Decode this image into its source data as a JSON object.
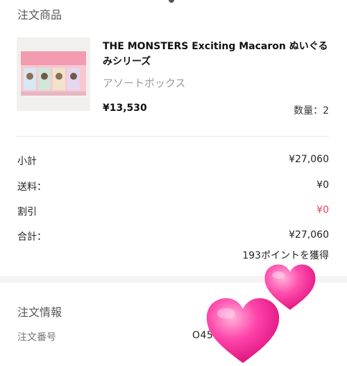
{
  "order_items": {
    "section_title": "注文商品",
    "product": {
      "name": "THE MONSTERS Exciting Macaron ぬいぐるみシリーズ",
      "variant": "アソートボックス",
      "price": "¥13,530",
      "quantity": "数量：2"
    }
  },
  "summary": {
    "subtotal": {
      "label": "小計",
      "value": "¥27,060"
    },
    "shipping": {
      "label": "送料：",
      "value": "¥0"
    },
    "discount": {
      "label": "割引",
      "value": "¥0"
    },
    "total": {
      "label": "合計：",
      "value": "¥27,060"
    },
    "points": "193ポイントを獲得"
  },
  "order_info": {
    "section_title": "注文情報",
    "order_number_label": "注文番号",
    "order_number_value": "O45             29717248"
  },
  "colors": {
    "discount": "#e0445d",
    "heart": "#ff3fa0"
  },
  "icons": [
    "heart-sticker-icon"
  ]
}
